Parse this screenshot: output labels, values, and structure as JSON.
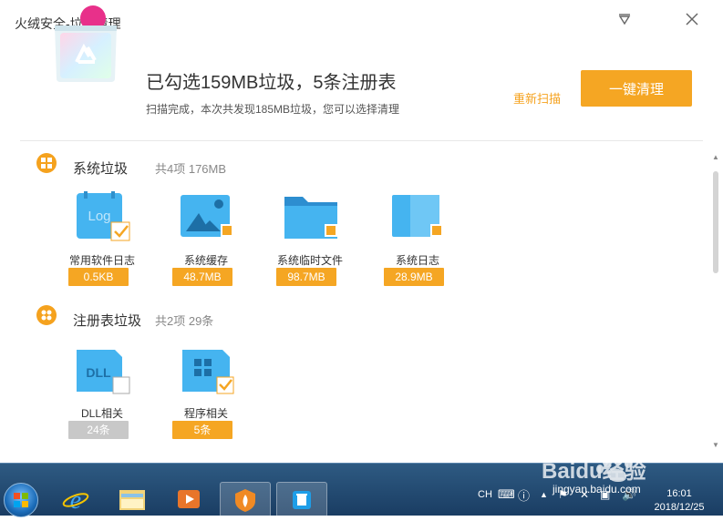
{
  "window": {
    "title": "火绒安全-垃圾清理",
    "menu_icon": "triangle-down-icon",
    "close_icon": "close-icon"
  },
  "summary": {
    "headline": "已勾选159MB垃圾，5条注册表",
    "subline": "扫描完成，本次共发现185MB垃圾，您可以选择清理",
    "rescan_label": "重新扫描",
    "clean_label": "一键清理"
  },
  "sections": [
    {
      "title": "系统垃圾",
      "subtitle": "共4项 176MB",
      "items": [
        {
          "label": "常用软件日志",
          "size": "0.5KB",
          "checked": true,
          "icon": "log-icon"
        },
        {
          "label": "系统缓存",
          "size": "48.7MB",
          "checked": true,
          "icon": "image-icon"
        },
        {
          "label": "系统临时文件",
          "size": "98.7MB",
          "checked": true,
          "icon": "folder-icon"
        },
        {
          "label": "系统日志",
          "size": "28.9MB",
          "checked": true,
          "icon": "book-icon"
        }
      ]
    },
    {
      "title": "注册表垃圾",
      "subtitle": "共2项 29条",
      "items": [
        {
          "label": "DLL相关",
          "size": "24条",
          "checked": false,
          "icon": "dll-icon"
        },
        {
          "label": "程序相关",
          "size": "5条",
          "checked": true,
          "icon": "program-icon"
        }
      ]
    }
  ],
  "taskbar": {
    "tray_lang": "CH",
    "time": "16:01",
    "date": "2018/12/25"
  },
  "watermark": {
    "text": "jingyan.baidu.com",
    "brand": "Baidu经验"
  },
  "colors": {
    "accent": "#f5a623",
    "icon_blue": "#45b4f0"
  }
}
